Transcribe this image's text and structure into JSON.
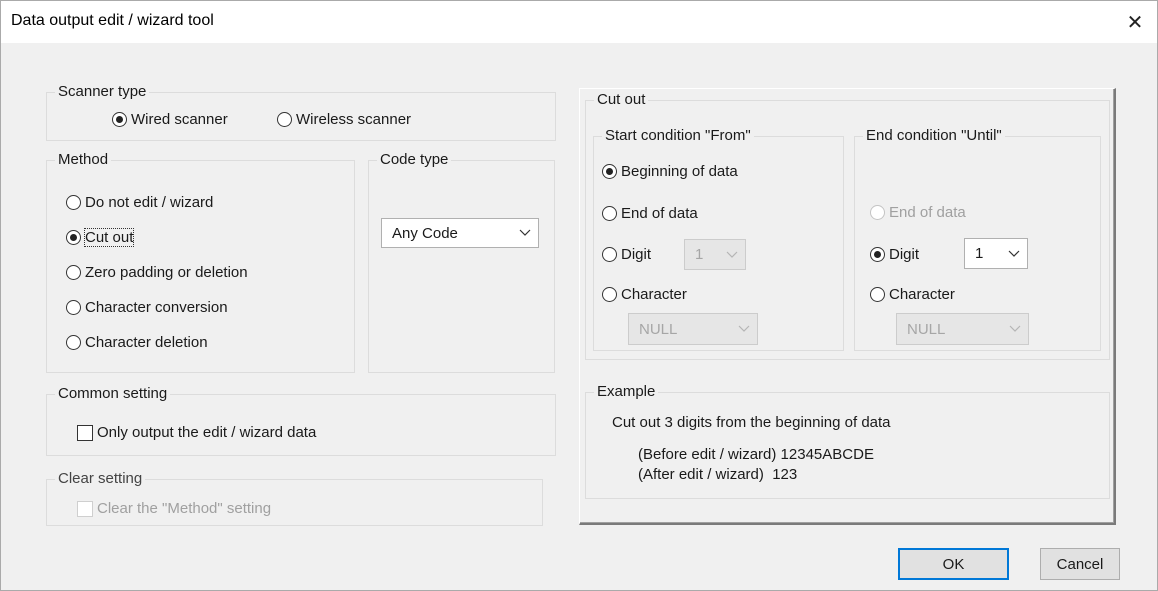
{
  "window": {
    "title": "Data output edit / wizard tool",
    "close_glyph": "✕"
  },
  "scanner_type": {
    "label": "Scanner type",
    "options": [
      "Wired scanner",
      "Wireless scanner"
    ],
    "selected": "Wired scanner"
  },
  "method": {
    "label": "Method",
    "options": [
      "Do not edit / wizard",
      "Cut out",
      "Zero padding or deletion",
      "Character conversion",
      "Character deletion"
    ],
    "selected": "Cut out"
  },
  "code_type": {
    "label": "Code type",
    "value": "Any Code"
  },
  "common_setting": {
    "label": "Common setting",
    "checkbox": "Only output the edit / wizard data",
    "checked": false
  },
  "clear_setting": {
    "label": "Clear setting",
    "checkbox": "Clear the \"Method\" setting",
    "checked": false,
    "enabled": false
  },
  "cut_out": {
    "label": "Cut out",
    "start": {
      "label": "Start condition \"From\"",
      "options": [
        "Beginning of data",
        "End of data",
        "Digit",
        "Character"
      ],
      "selected": "Beginning of data",
      "digit_value": "1",
      "character_value": "NULL"
    },
    "end": {
      "label": "End condition \"Until\"",
      "options": [
        "End of data",
        "Digit",
        "Character"
      ],
      "selected": "Digit",
      "digit_value": "1",
      "character_value": "NULL"
    }
  },
  "example": {
    "label": "Example",
    "description": "Cut out 3 digits from the beginning of data",
    "before": "(Before edit / wizard) 12345ABCDE",
    "after": "(After edit / wizard)  123"
  },
  "buttons": {
    "ok": "OK",
    "cancel": "Cancel"
  },
  "colors": {
    "accent": "#0078d7",
    "dialog_bg": "#f0f0f0",
    "disabled_text": "#a0a0a0"
  }
}
